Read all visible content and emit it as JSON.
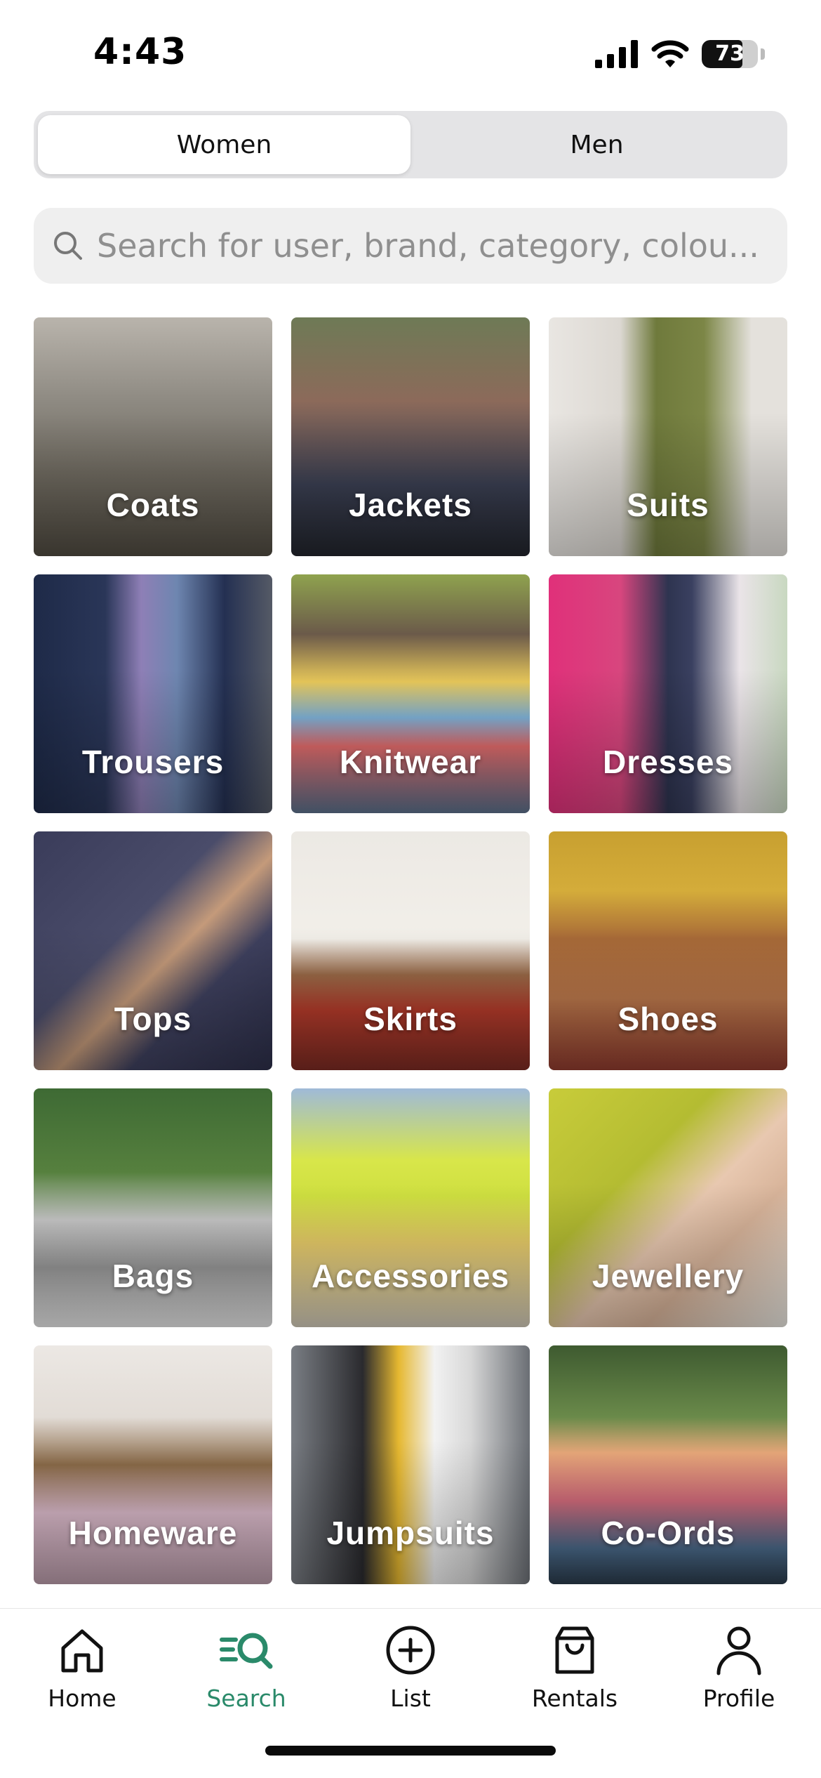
{
  "status_bar": {
    "time": "4:43",
    "battery": "73",
    "battery_level": 0.73
  },
  "segmented": {
    "women": "Women",
    "men": "Men",
    "selected": "Women"
  },
  "search": {
    "placeholder": "Search for user, brand, category, colou..."
  },
  "categories": [
    {
      "label": "Coats"
    },
    {
      "label": "Jackets"
    },
    {
      "label": "Suits"
    },
    {
      "label": "Trousers"
    },
    {
      "label": "Knitwear"
    },
    {
      "label": "Dresses"
    },
    {
      "label": "Tops"
    },
    {
      "label": "Skirts"
    },
    {
      "label": "Shoes"
    },
    {
      "label": "Bags"
    },
    {
      "label": "Accessories"
    },
    {
      "label": "Jewellery"
    },
    {
      "label": "Homeware"
    },
    {
      "label": "Jumpsuits"
    },
    {
      "label": "Co-Ords"
    }
  ],
  "nav": {
    "home": "Home",
    "search": "Search",
    "list": "List",
    "rentals": "Rentals",
    "profile": "Profile",
    "active": "Search",
    "active_color": "#2a8a6a"
  }
}
